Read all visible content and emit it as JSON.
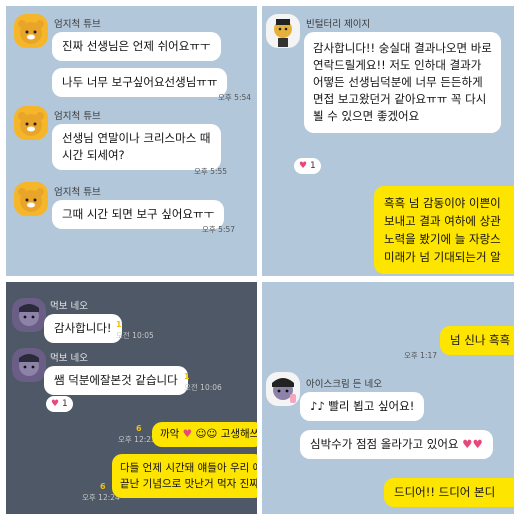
{
  "panel_top_left": {
    "sender": "엄지척 튜브",
    "messages": [
      "진짜 선생님은 언제 쉬어요ㅠㅜ",
      "나두 너무 보구싶어요선생님ㅠㅠ",
      "선생님 연말이나 크리스마스 때",
      "시간 되세여?",
      "그때 시간 되면 보구 싶어요ㅠㅜ"
    ],
    "times": [
      "오후 5:54",
      "오후 5:55",
      "오후 5:57"
    ]
  },
  "panel_top_right": {
    "sender": "빈털터리 제이지",
    "message_lines": [
      "감사합니다!! 숭실대 결과나오면 바로",
      "연락드릴게요!! 저도 인하대 결과가",
      "어떻든 선생님덕분에 너무 든든하게",
      "면접 보고왔던거 같아요ㅠㅠ 꼭 다시",
      "뵐 수 있으면 좋겠어요"
    ],
    "reaction_count": "1",
    "my_message_lines": [
      "흑흑 넘 감동이야 이쁜이",
      "보내고 결과 여하에 상관",
      "노력을 봤기에 늘 자랑스",
      "미래가 넘 기대되는거 알"
    ]
  },
  "panel_bottom_left": {
    "sender": "먹보 네오",
    "messages": [
      "감사합니다!",
      "쌤 덕분에잘본것 같습니다"
    ],
    "times": [
      "오전 10:05",
      "오전 10:06",
      "오후 12:23",
      "오후 12:24"
    ],
    "read_counts": [
      "1",
      "1",
      "6",
      "6"
    ],
    "reaction_count": "1",
    "my_messages": [
      "까악",
      "고생해쓰",
      "다들 언제 시간돼 얘들아 우리 애",
      "끝난 기념으로 맛난거 먹자 진짜"
    ]
  },
  "panel_bottom_right": {
    "my_message_top": "넘 신나 흑흑",
    "time_top": "오후 1:17",
    "sender": "아이스크림 든 네오",
    "messages": [
      "빨리 뵙고 싶어요!",
      "심박수가 점점 올라가고 있어요"
    ],
    "my_message_bottom": "드디어!! 드디어 본디"
  },
  "colors": {
    "chat_bg": "#b2c7da",
    "dark_chat_bg": "#4e5867",
    "my_bubble": "#fee500",
    "other_bubble": "#ffffff",
    "heart": "#e8477a"
  }
}
